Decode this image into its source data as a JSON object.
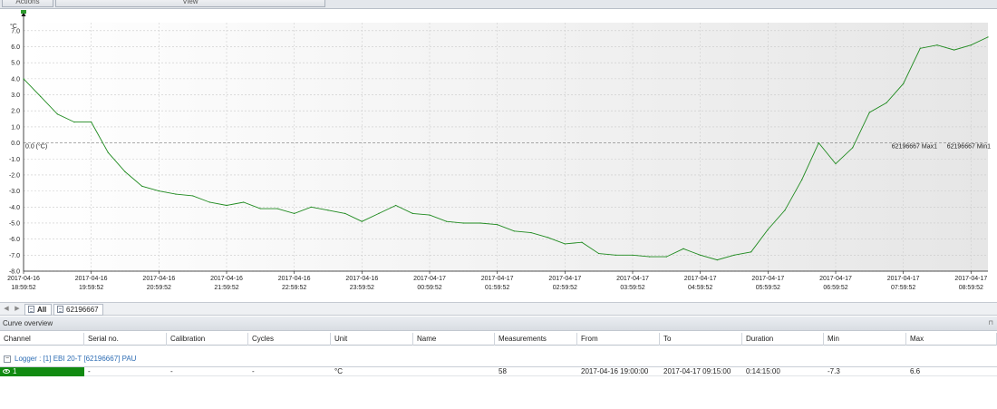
{
  "ribbon": {
    "tabs": [
      "Actions",
      "View"
    ]
  },
  "chart_data": {
    "type": "line",
    "y_unit": "°C",
    "ylim": [
      -8.0,
      7.5
    ],
    "y_ticks": [
      "7.0",
      "6.0",
      "5.0",
      "4.0",
      "3.0",
      "2.0",
      "1.0",
      "0.0",
      "-1.0",
      "-2.0",
      "-3.0",
      "-4.0",
      "-5.0",
      "-6.0",
      "-7.0",
      "-8.0"
    ],
    "x_ticks": [
      [
        "2017-04-16",
        "18:59:52"
      ],
      [
        "2017-04-16",
        "19:59:52"
      ],
      [
        "2017-04-16",
        "20:59:52"
      ],
      [
        "2017-04-16",
        "21:59:52"
      ],
      [
        "2017-04-16",
        "22:59:52"
      ],
      [
        "2017-04-16",
        "23:59:52"
      ],
      [
        "2017-04-17",
        "00:59:52"
      ],
      [
        "2017-04-17",
        "01:59:52"
      ],
      [
        "2017-04-17",
        "02:59:52"
      ],
      [
        "2017-04-17",
        "03:59:52"
      ],
      [
        "2017-04-17",
        "04:59:52"
      ],
      [
        "2017-04-17",
        "05:59:52"
      ],
      [
        "2017-04-17",
        "06:59:52"
      ],
      [
        "2017-04-17",
        "07:59:52"
      ],
      [
        "2017-04-17",
        "08:59:52"
      ]
    ],
    "x_range_hours": [
      0,
      14.25
    ],
    "reference_line": {
      "value": 0.0,
      "label": "0.0 (°C)"
    },
    "limit_labels": [
      "62196667 Max1",
      "62196667 Min1"
    ],
    "grid": true,
    "series": [
      {
        "color": "#1f8a1f",
        "points": [
          [
            0.0,
            4.0
          ],
          [
            0.25,
            2.9
          ],
          [
            0.5,
            1.8
          ],
          [
            0.75,
            1.3
          ],
          [
            1.0,
            1.3
          ],
          [
            1.25,
            -0.6
          ],
          [
            1.5,
            -1.8
          ],
          [
            1.75,
            -2.7
          ],
          [
            2.0,
            -3.0
          ],
          [
            2.25,
            -3.2
          ],
          [
            2.5,
            -3.3
          ],
          [
            2.75,
            -3.7
          ],
          [
            3.0,
            -3.9
          ],
          [
            3.25,
            -3.7
          ],
          [
            3.5,
            -4.1
          ],
          [
            3.75,
            -4.1
          ],
          [
            4.0,
            -4.4
          ],
          [
            4.25,
            -4.0
          ],
          [
            4.5,
            -4.2
          ],
          [
            4.75,
            -4.4
          ],
          [
            5.0,
            -4.9
          ],
          [
            5.25,
            -4.4
          ],
          [
            5.5,
            -3.9
          ],
          [
            5.75,
            -4.4
          ],
          [
            6.0,
            -4.5
          ],
          [
            6.25,
            -4.9
          ],
          [
            6.5,
            -5.0
          ],
          [
            6.75,
            -5.0
          ],
          [
            7.0,
            -5.1
          ],
          [
            7.25,
            -5.5
          ],
          [
            7.5,
            -5.6
          ],
          [
            7.75,
            -5.9
          ],
          [
            8.0,
            -6.3
          ],
          [
            8.25,
            -6.2
          ],
          [
            8.5,
            -6.9
          ],
          [
            8.75,
            -7.0
          ],
          [
            9.0,
            -7.0
          ],
          [
            9.25,
            -7.1
          ],
          [
            9.5,
            -7.1
          ],
          [
            9.75,
            -6.6
          ],
          [
            10.0,
            -7.0
          ],
          [
            10.25,
            -7.3
          ],
          [
            10.5,
            -7.0
          ],
          [
            10.75,
            -6.8
          ],
          [
            11.0,
            -5.4
          ],
          [
            11.25,
            -4.2
          ],
          [
            11.5,
            -2.3
          ],
          [
            11.75,
            0.0
          ],
          [
            12.0,
            -1.3
          ],
          [
            12.25,
            -0.3
          ],
          [
            12.5,
            1.9
          ],
          [
            12.75,
            2.5
          ],
          [
            13.0,
            3.7
          ],
          [
            13.25,
            5.9
          ],
          [
            13.5,
            6.1
          ],
          [
            13.75,
            5.8
          ],
          [
            14.0,
            6.1
          ],
          [
            14.25,
            6.6
          ]
        ]
      }
    ]
  },
  "tabstrip": {
    "tabs": [
      "All",
      "62196667"
    ]
  },
  "overview": {
    "title": "Curve overview",
    "columns": [
      "Channel",
      "Serial no.",
      "Calibration",
      "Cycles",
      "Unit",
      "Name",
      "Measurements",
      "From",
      "To",
      "Duration",
      "Min",
      "Max"
    ],
    "group_toggle": "−",
    "group_label": "Logger : [1] EBI 20-T [62196667] PAU",
    "row": {
      "channel": "1",
      "serial": "-",
      "calibration": "-",
      "cycles": "-",
      "unit": "°C",
      "name": "",
      "measurements": "58",
      "from": "2017-04-16 19:00:00",
      "to": "2017-04-17 09:15:00",
      "duration": "0:14:15:00",
      "min": "-7.3",
      "max": "6.6"
    }
  }
}
